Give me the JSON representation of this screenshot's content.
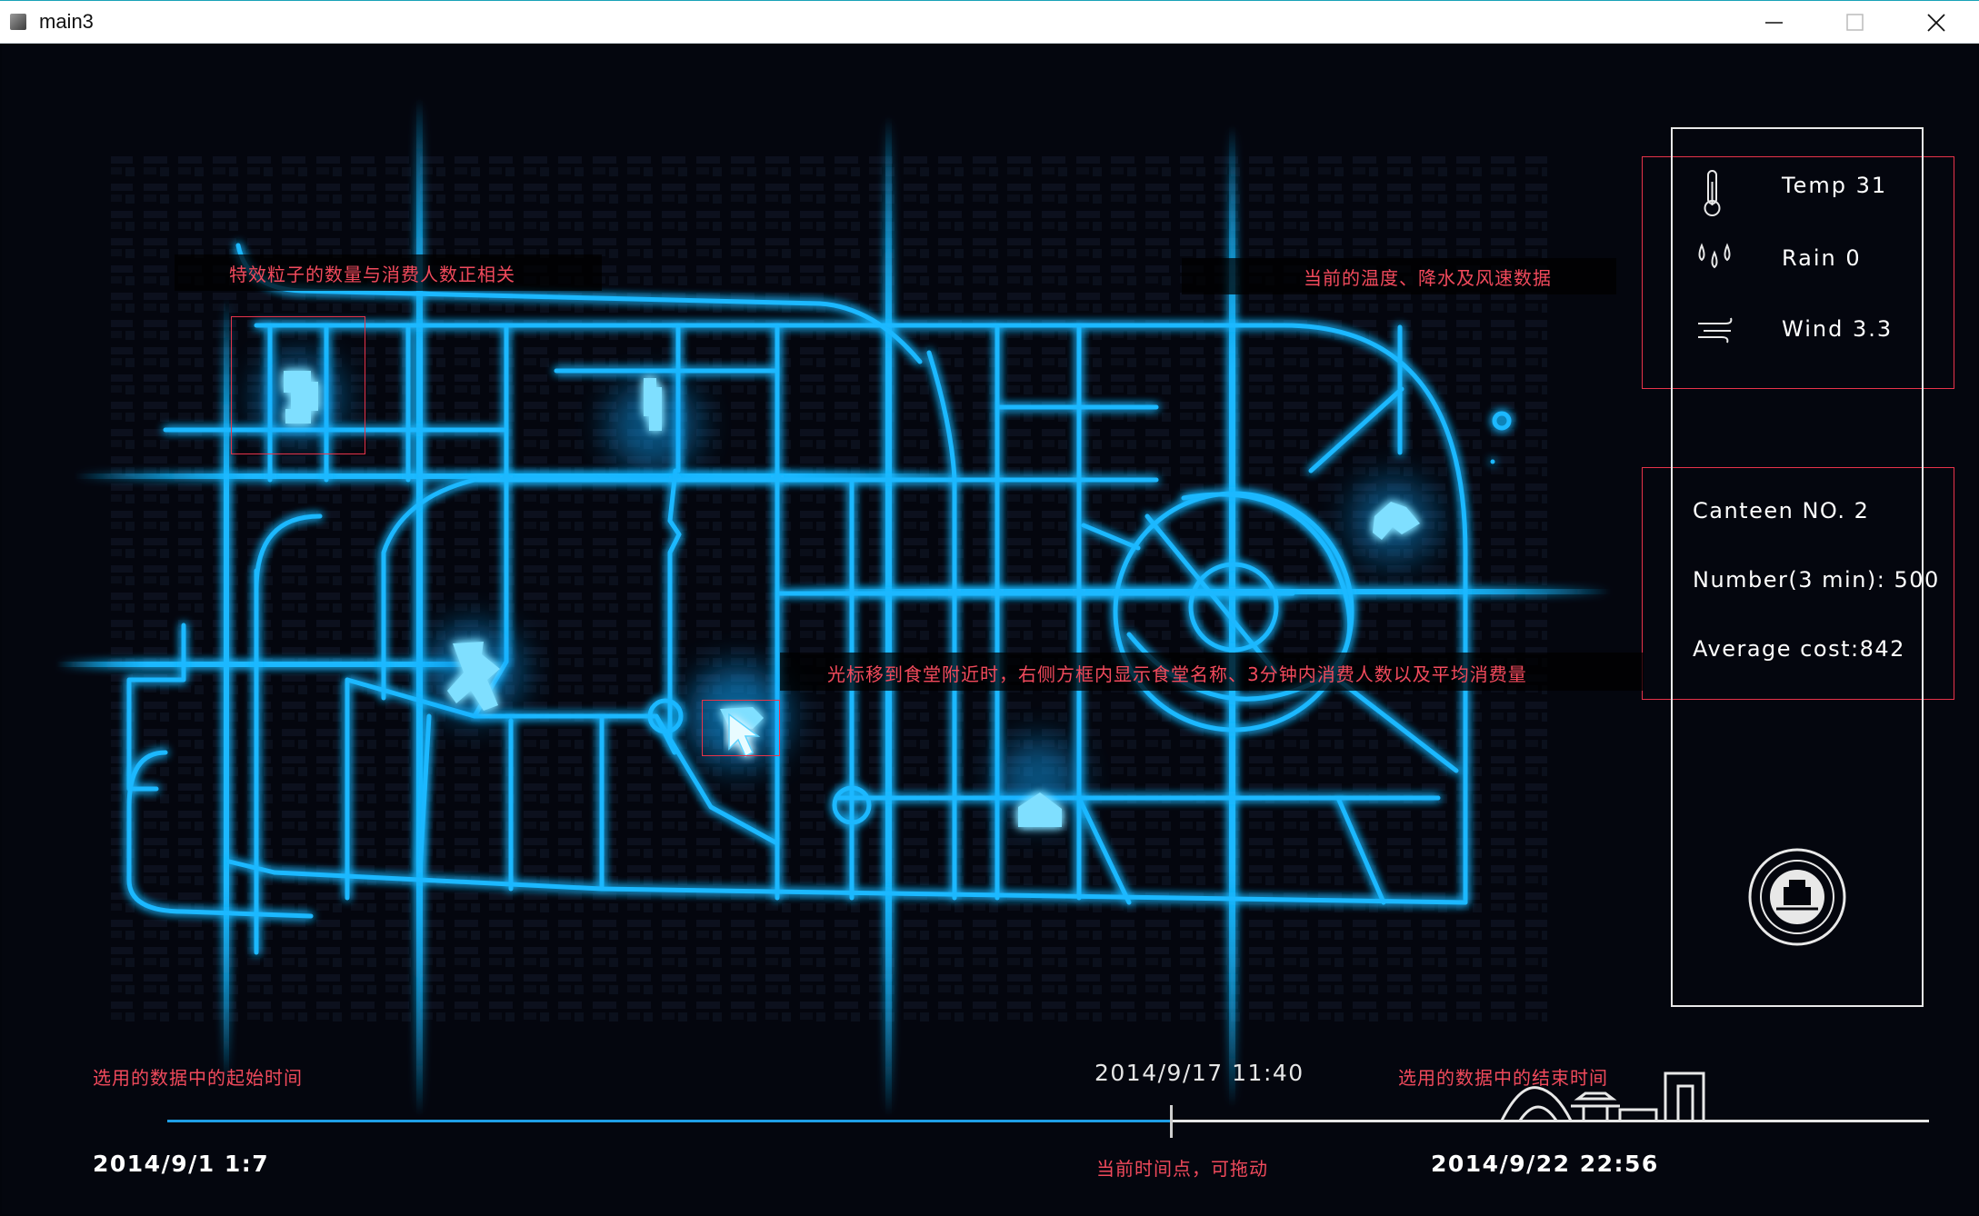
{
  "window": {
    "title": "main3",
    "minimize_icon": "minimize-icon",
    "maximize_icon": "maximize-icon",
    "close_icon": "close-icon"
  },
  "annotations": {
    "particles": "特效粒子的数量与消费人数正相关",
    "weather": "当前的温度、降水及风速数据",
    "hover": "光标移到食堂附近时，右侧方框内显示食堂名称、3分钟内消费人数以及平均消费量",
    "start_time": "选用的数据中的起始时间",
    "end_time": "选用的数据中的结束时间",
    "current_point": "当前时间点，可拖动"
  },
  "weather": {
    "temp": "Temp 31",
    "rain": "Rain  0",
    "wind": "Wind 3.3",
    "icons": [
      "thermometer-icon",
      "raindrops-icon",
      "wind-icon"
    ]
  },
  "canteen": {
    "name": "Canteen  NO. 2",
    "number": "Number(3 min): 500",
    "average": "Average cost:842"
  },
  "timeline": {
    "start": "2014/9/1 1:7",
    "current": "2014/9/17 11:40",
    "end": "2014/9/22 22:56",
    "progress": 0.57
  },
  "colors": {
    "road": "#1ab8ff",
    "glow": "#00a8ff",
    "annotation": "#f24a5c",
    "timeline_played": "#1e9ee6"
  },
  "logo": "university-seal-logo"
}
